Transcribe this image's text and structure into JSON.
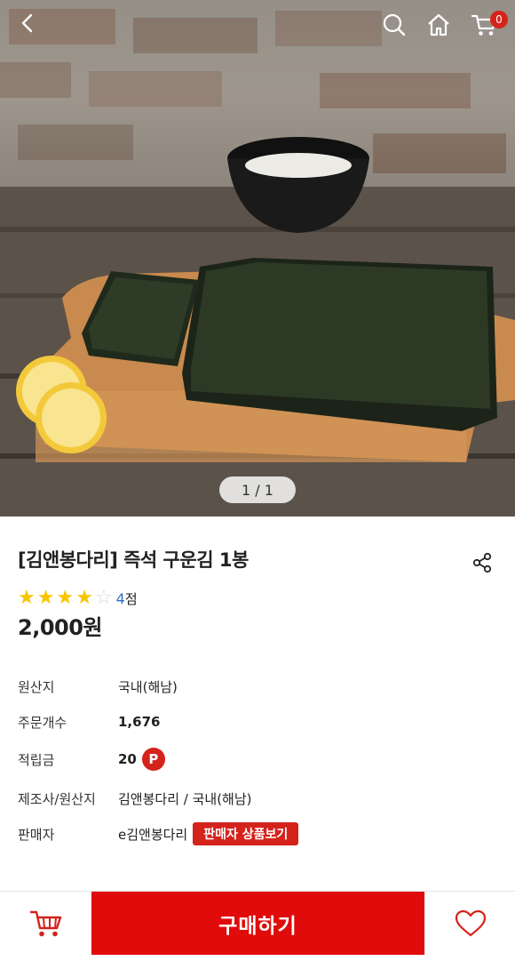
{
  "header": {
    "back_icon": "chevron-left-icon",
    "search_icon": "search-icon",
    "home_icon": "home-icon",
    "cart_icon": "cart-icon",
    "cart_count": "0"
  },
  "gallery": {
    "pager": "1 / 1"
  },
  "product": {
    "title": "[김앤봉다리] 즉석 구운김 1봉",
    "rating": 4,
    "rating_max": 5,
    "rating_value": "4",
    "rating_unit": "점",
    "price": "2,000원"
  },
  "specs": [
    {
      "label": "원산지",
      "value": "국내(해남)"
    },
    {
      "label": "주문개수",
      "value": "1,676"
    },
    {
      "label": "적립금",
      "value": "20",
      "badge": "P"
    },
    {
      "label": "제조사/원산지",
      "value": "김앤봉다리 / 국내(해남)"
    },
    {
      "label": "판매자",
      "value": "e김앤봉다리",
      "button": "판매자 상품보기"
    }
  ],
  "bottom_bar": {
    "buy_label": "구매하기",
    "cart_icon": "cart-icon",
    "wishlist_icon": "heart-icon"
  },
  "colors": {
    "accent": "#e00b0b",
    "badge": "#d4231b",
    "star": "#f8c400",
    "rating_text": "#2e72c6"
  }
}
